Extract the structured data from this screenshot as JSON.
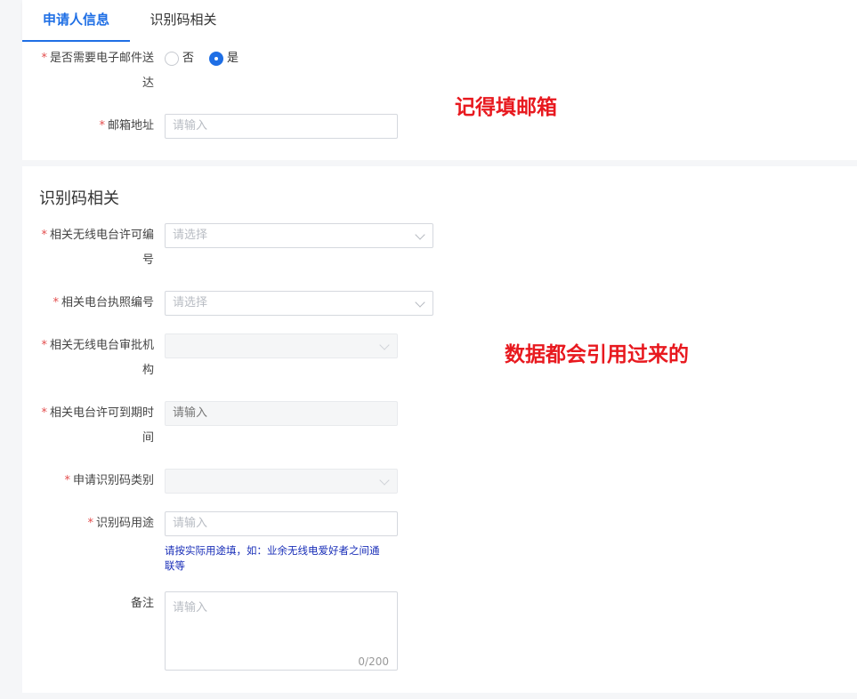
{
  "tabs": [
    {
      "label": "申请人信息",
      "active": true
    },
    {
      "label": "识别码相关",
      "active": false
    }
  ],
  "email_section": {
    "email_delivery": {
      "label_line1": "是否需要电子邮件送",
      "label_line2": "达",
      "options": [
        "否",
        "是"
      ],
      "selected": "是"
    },
    "email_address": {
      "label": "邮箱地址",
      "placeholder": "请输入"
    }
  },
  "identification_section": {
    "title": "识别码相关",
    "radio_license_no": {
      "label_line1": "相关无线电台许可编",
      "label_line2": "号",
      "placeholder": "请选择"
    },
    "station_license_no": {
      "label": "相关电台执照编号",
      "placeholder": "请选择"
    },
    "approval_authority": {
      "label_line1": "相关无线电台审批机",
      "label_line2": "构",
      "value": ""
    },
    "license_expiry": {
      "label_line1": "相关电台许可到期时",
      "label_line2": "间",
      "placeholder": "请输入"
    },
    "code_category": {
      "label": "申请识别码类别",
      "value": ""
    },
    "code_usage": {
      "label": "识别码用途",
      "placeholder": "请输入",
      "hint_line1": "请按实际用途填，如：业余无线电爱好者之间通",
      "hint_line2": "联等"
    },
    "remarks": {
      "label": "备注",
      "placeholder": "请输入",
      "counter": "0/200"
    }
  },
  "annotations": {
    "note1": "记得填邮箱",
    "note2": "数据都会引用过来的"
  },
  "colors": {
    "accent": "#1f6fe5",
    "required": "#e34d4d",
    "annotation": "#e8191f",
    "hint": "#1a2fb8"
  }
}
